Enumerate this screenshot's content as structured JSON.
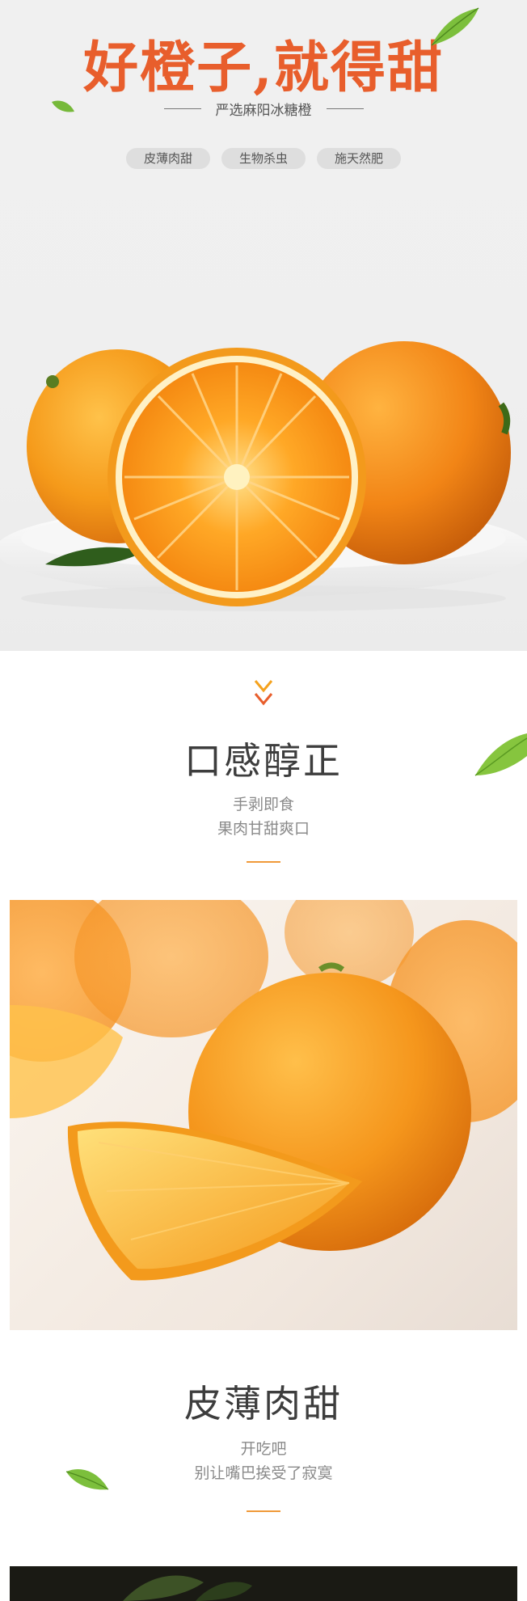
{
  "hero": {
    "title": "好橙子,就得甜",
    "subtitle": "严选麻阳冰糖橙",
    "tags": [
      "皮薄肉甜",
      "生物杀虫",
      "施天然肥"
    ]
  },
  "section1": {
    "title": "口感醇正",
    "lines": [
      "手剥即食",
      "果肉甘甜爽口"
    ]
  },
  "section2": {
    "title": "皮薄肉甜",
    "lines": [
      "开吃吧",
      "别让嘴巴挨受了寂寞"
    ]
  },
  "colors": {
    "accent": "#e85e2c",
    "orange": "#f5901e",
    "heading": "#3d3d3d",
    "body_text": "#8a8a8a",
    "pill_bg": "#dedede"
  },
  "icons": [
    "leaf-icon",
    "double-chevron-down-icon"
  ]
}
